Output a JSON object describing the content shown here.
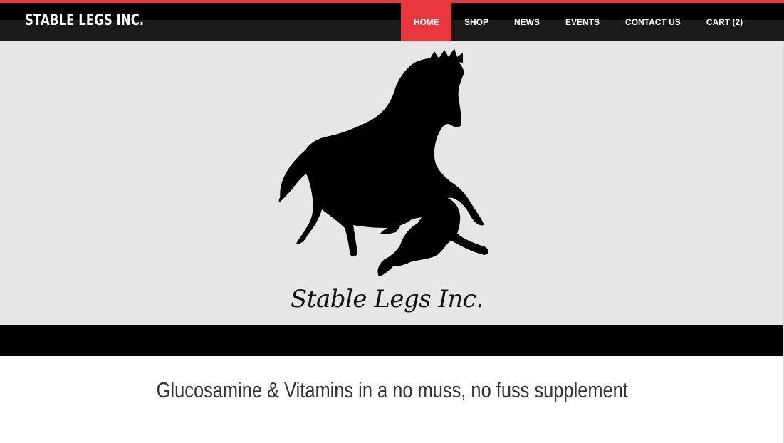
{
  "header": {
    "site_title": "STABLE LEGS INC."
  },
  "nav": {
    "items": [
      {
        "label": "HOME",
        "active": true
      },
      {
        "label": "SHOP",
        "active": false
      },
      {
        "label": "NEWS",
        "active": false
      },
      {
        "label": "EVENTS",
        "active": false
      },
      {
        "label": "CONTACT US",
        "active": false
      },
      {
        "label": "CART (2)",
        "active": false
      }
    ]
  },
  "hero": {
    "logo_text": "Stable Legs Inc.",
    "icons": [
      "horse-silhouette-icon",
      "dog-silhouette-icon"
    ]
  },
  "main": {
    "tagline": "Glucosamine & Vitamins in a no muss, no fuss supplement"
  },
  "colors": {
    "accent": "#e8383d",
    "header_bg": "#1b1b1b",
    "hero_bg": "#e6e6e6",
    "text_dark": "#333333"
  }
}
